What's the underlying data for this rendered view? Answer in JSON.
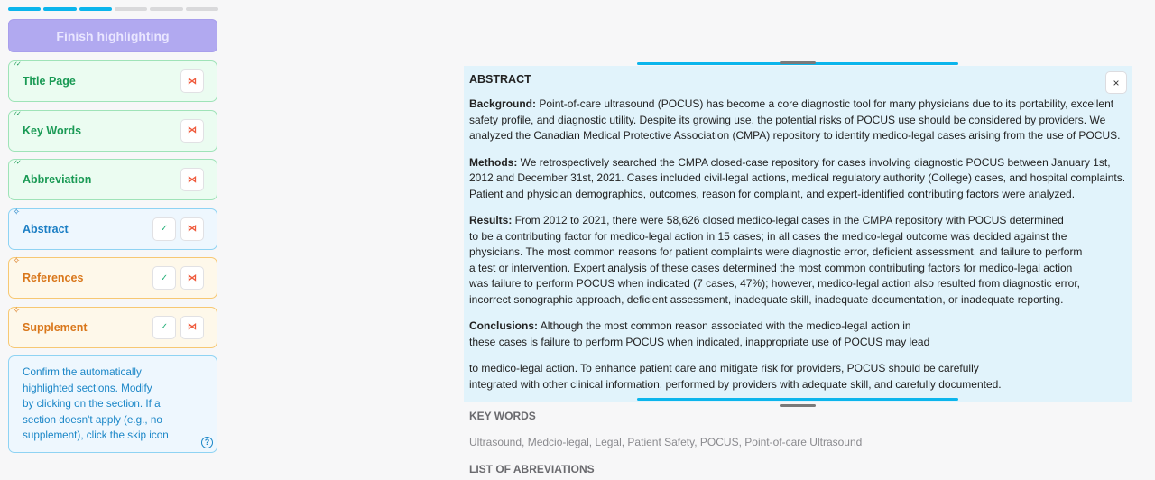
{
  "progress": {
    "total_steps": 6,
    "completed_steps": 3
  },
  "sidebar": {
    "finish_label": "Finish highlighting",
    "sections": [
      {
        "label": "Title Page",
        "state": "confirmed",
        "state_icon": "double-check-icon",
        "buttons": [
          "skip"
        ]
      },
      {
        "label": "Key Words",
        "state": "confirmed",
        "state_icon": "double-check-icon",
        "buttons": [
          "skip"
        ]
      },
      {
        "label": "Abbreviation",
        "state": "confirmed",
        "state_icon": "double-check-icon",
        "buttons": [
          "skip"
        ]
      },
      {
        "label": "Abstract",
        "state": "auto-active",
        "state_icon": "sparkle-icon",
        "buttons": [
          "confirm",
          "skip"
        ]
      },
      {
        "label": "References",
        "state": "auto",
        "state_icon": "sparkle-icon",
        "buttons": [
          "confirm",
          "skip"
        ]
      },
      {
        "label": "Supplement",
        "state": "auto",
        "state_icon": "sparkle-icon",
        "buttons": [
          "confirm",
          "skip"
        ]
      }
    ],
    "help_text": "Confirm the automatically\nhighlighted sections. Modify\nby clicking on the section. If a\nsection doesn't apply (e.g., no\nsupplement), click the skip icon",
    "icons": {
      "skip": "⋈",
      "confirm": "✓",
      "close": "×",
      "help": "?"
    }
  },
  "document": {
    "abstract_title": "ABSTRACT",
    "paragraphs": [
      {
        "label": "Background:",
        "text": " Point-of-care ultrasound (POCUS) has become a core diagnostic tool for many physicians due to its portability, excellent\nsafety profile, and diagnostic utility. Despite its growing use, the potential risks of POCUS use should be considered by providers. We\nanalyzed the Canadian Medical Protective Association (CMPA) repository to identify medico-legal cases arising from the use of POCUS."
      },
      {
        "label": "Methods:",
        "text": " We retrospectively searched the CMPA closed-case repository for cases involving diagnostic POCUS between January 1st,\n2012 and December 31st, 2021. Cases included civil-legal actions, medical regulatory authority (College) cases, and hospital complaints.\nPatient and physician demographics, outcomes, reason for complaint, and expert-identified contributing factors were analyzed."
      },
      {
        "label": "Results:",
        "text": " From 2012 to 2021, there were 58,626 closed medico-legal cases in the CMPA repository with POCUS determined\nto be a contributing factor for medico-legal action in 15 cases; in all cases the medico-legal outcome was decided against the\nphysicians. The most common reasons for patient complaints were diagnostic error, deficient assessment, and failure to perform\na test or intervention. Expert analysis of these cases determined the most common contributing factors for medico-legal action\nwas failure to perform POCUS when indicated (7 cases, 47%); however, medico-legal action also resulted from diagnostic error,\nincorrect sonographic approach, deficient assessment, inadequate skill, inadequate documentation, or inadequate reporting."
      },
      {
        "label": "Conclusions:",
        "text": " Although the most common reason associated with the medico-legal action in\nthese cases is failure to perform POCUS when indicated, inappropriate use of POCUS may lead"
      },
      {
        "label": "",
        "text": "to medico-legal action. To enhance patient care and mitigate risk for providers, POCUS should be carefully\nintegrated with other clinical information, performed by providers with adequate skill, and carefully documented."
      }
    ],
    "keywords_title": "KEY WORDS",
    "keywords_text": "Ultrasound, Medcio-legal, Legal, Patient Safety, POCUS, Point-of-care Ultrasound",
    "abbrev_title": "LIST OF ABREVIATIONS"
  }
}
